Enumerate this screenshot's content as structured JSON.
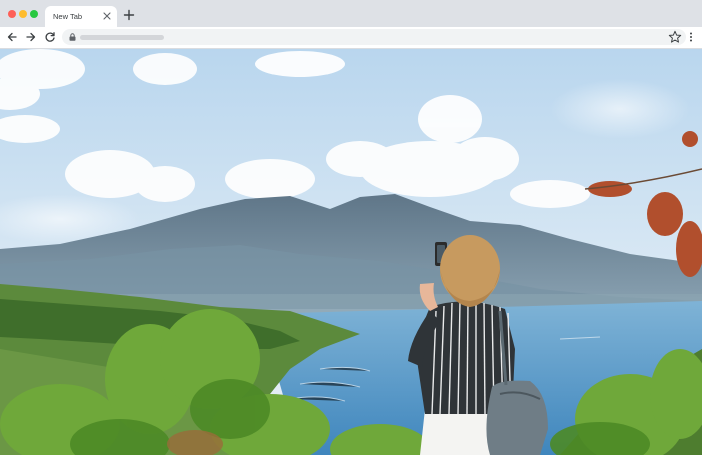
{
  "browser": {
    "tabs": [
      {
        "title": "New Tab"
      }
    ],
    "new_tab_icon": "plus-icon",
    "toolbar": {
      "back_icon": "arrow-left-icon",
      "forward_icon": "arrow-right-icon",
      "reload_icon": "reload-icon",
      "lock_icon": "lock-icon",
      "bookmark_icon": "star-icon",
      "menu_icon": "kebab-menu-icon"
    }
  },
  "page": {
    "content": "photo",
    "colors": {
      "sky": "#cfe3f3",
      "mountains": "#6f8796",
      "sea": "#5f9cc7",
      "foliage": "#4e8a2a"
    }
  }
}
